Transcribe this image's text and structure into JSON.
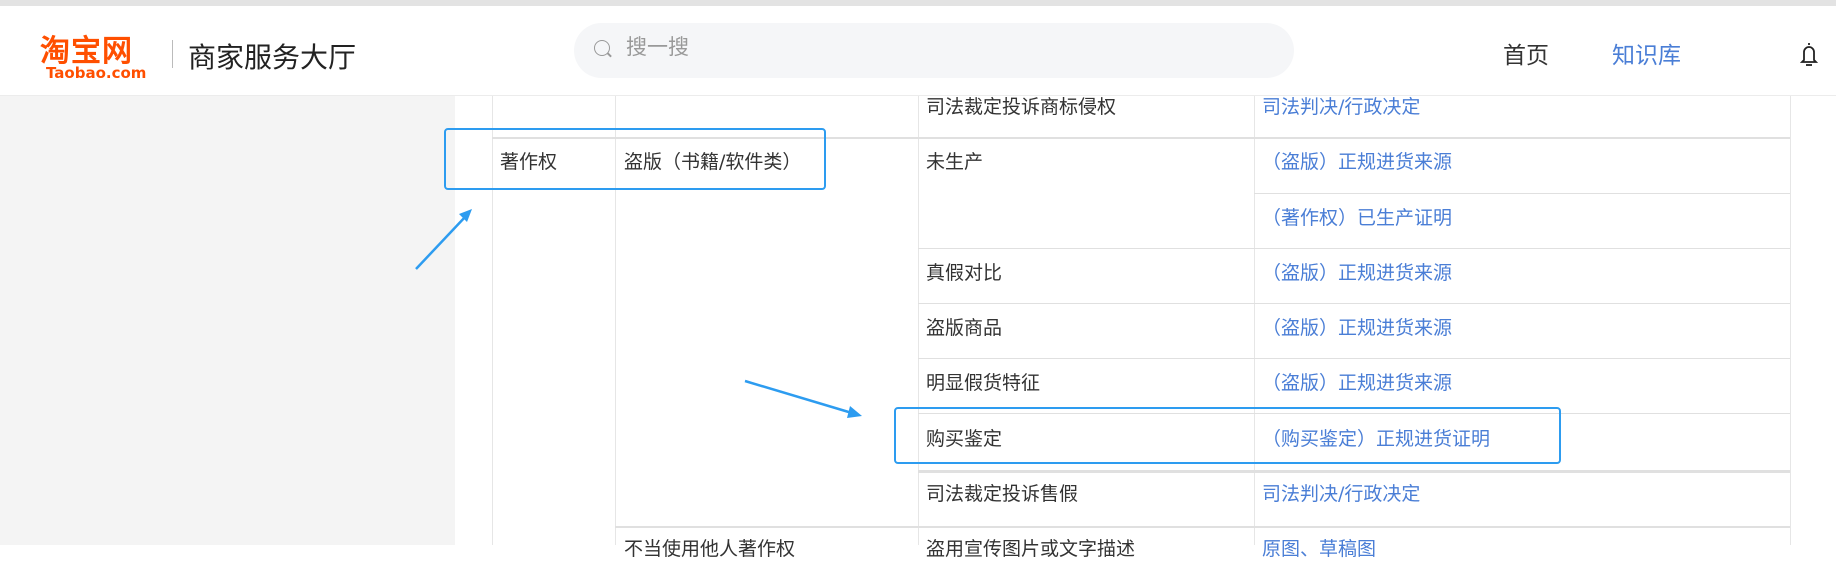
{
  "header": {
    "logo_cn": "淘宝网",
    "logo_en": "Taobao.com",
    "title": "商家服务大厅",
    "search_placeholder": "搜一搜",
    "nav": [
      {
        "label": "首页"
      },
      {
        "label": "知识库"
      }
    ]
  },
  "table": {
    "top_row": {
      "evidence": "司法裁定投诉商标侵权",
      "material": "司法判决/行政决定"
    },
    "category": "著作权",
    "subcategory": "盗版（书籍/软件类）",
    "rows": [
      {
        "evidence": "未生产",
        "material": "（盗版）正规进货来源"
      },
      {
        "evidence": "",
        "material": "（著作权）已生产证明"
      },
      {
        "evidence": "真假对比",
        "material": "（盗版）正规进货来源"
      },
      {
        "evidence": "盗版商品",
        "material": "（盗版）正规进货来源"
      },
      {
        "evidence": "明显假货特征",
        "material": "（盗版）正规进货来源"
      },
      {
        "evidence": "购买鉴定",
        "material": "（购买鉴定）正规进货证明"
      },
      {
        "evidence": "司法裁定投诉售假",
        "material": "司法判决/行政决定"
      }
    ],
    "bottom_row": {
      "subcategory": "不当使用他人著作权",
      "evidence": "盗用宣传图片或文字描述",
      "material": "原图、草稿图"
    }
  },
  "colors": {
    "accent": "#4a7ed6",
    "highlight": "#2d9cf0",
    "brand": "#ff4f00"
  }
}
